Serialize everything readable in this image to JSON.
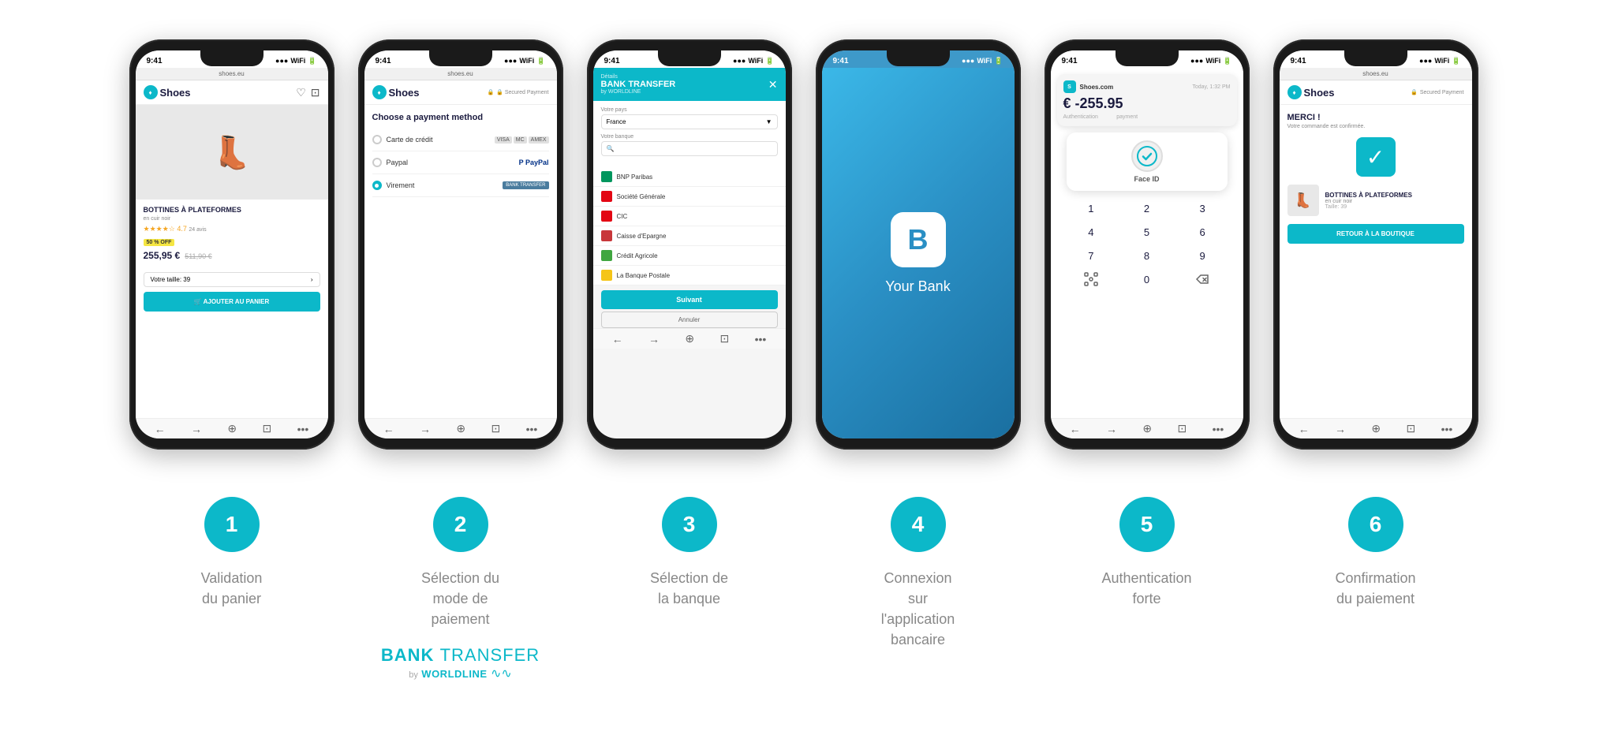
{
  "status_bar": {
    "time": "9:41",
    "signal": "●●●",
    "wifi": "WiFi",
    "battery": "⬛"
  },
  "phones": [
    {
      "id": "phone1",
      "browser_url": "shoes.eu",
      "header": {
        "logo": "Shoes",
        "icon1": "♡",
        "icon2": "⊡"
      },
      "product": {
        "name": "BOTTINES À PLATEFORMES",
        "sub": "en cuir noir",
        "stars": "★★★★☆",
        "rating": "4.7",
        "reviews": "24 avis",
        "badge": "50 % OFF",
        "price": "255,95 €",
        "price_old": "511,90 €",
        "size_label": "Votre taille: 39",
        "cta": "🛒 AJOUTER AU PANIER"
      },
      "bottom": [
        "←",
        "→",
        "⊕",
        "⊡",
        "•••"
      ]
    },
    {
      "id": "phone2",
      "browser_url": "shoes.eu",
      "header": {
        "logo": "Shoes",
        "secured": "🔒 Secured Payment"
      },
      "title": "Choose a payment method",
      "options": [
        {
          "label": "Carte de crédit",
          "type": "cards",
          "selected": false
        },
        {
          "label": "Paypal",
          "type": "paypal",
          "selected": false
        },
        {
          "label": "Virement",
          "type": "bank_transfer",
          "selected": true
        }
      ],
      "bottom": [
        "←",
        "→",
        "⊕",
        "⊡",
        "•••"
      ]
    },
    {
      "id": "phone3",
      "header_title": "BANK TRANSFER",
      "header_sub": "by WORLDLINE",
      "details_label": "Détails",
      "country_label": "Votre pays",
      "country_value": "France",
      "bank_label": "Votre banque",
      "banks": [
        {
          "name": "BNP Paribas",
          "color": "#00965e"
        },
        {
          "name": "Société Générale",
          "color": "#e30613"
        },
        {
          "name": "CIC",
          "color": "#e30613"
        },
        {
          "name": "Caisse d'Epargne",
          "color": "#c8373a"
        },
        {
          "name": "Crédit Agricole",
          "color": "#40a640"
        },
        {
          "name": "La Banque Postale",
          "color": "#f5c518"
        }
      ],
      "cta": "Suivant",
      "cancel": "Annuler",
      "bottom": [
        "←",
        "→",
        "⊕",
        "⊡",
        "•••"
      ]
    },
    {
      "id": "phone4",
      "bank_letter": "B",
      "bank_name": "Your Bank"
    },
    {
      "id": "phone5",
      "notif_app": "Shoes.com",
      "notif_time": "Today, 1:32 PM",
      "amount": "€ -255.95",
      "notif_sub": "Authentication",
      "faceid_label": "Face ID",
      "pin_keys": [
        [
          "1",
          "2",
          "3"
        ],
        [
          "4",
          "5",
          "6"
        ],
        [
          "7",
          "8",
          "9"
        ],
        [
          "⊡",
          "0",
          "⌫"
        ]
      ],
      "bottom": [
        "←",
        "→",
        "⊕",
        "⊡",
        "•••"
      ]
    },
    {
      "id": "phone6",
      "browser_url": "shoes.eu",
      "header": {
        "logo": "Shoes",
        "secured": "🔒 Secured Payment"
      },
      "merci": "MERCI !",
      "sub": "Votre commande est confirmée.",
      "check": "✓",
      "product_name": "BOTTINES À PLATEFORMES",
      "product_sub": "en cuir noir",
      "taille": "Taille: 39",
      "return_btn": "RETOUR À LA BOUTIQUE",
      "bottom": [
        "←",
        "→",
        "⊕",
        "⊡",
        "•••"
      ]
    }
  ],
  "steps": [
    {
      "number": "1",
      "label": "Validation\ndu panier"
    },
    {
      "number": "2",
      "label": "Sélection du\nmode de\npaiement"
    },
    {
      "number": "3",
      "label": "Sélection de\nla banque"
    },
    {
      "number": "4",
      "label": "Connexion\nsur\nl'application\nbancaire"
    },
    {
      "number": "5",
      "label": "Authentication\nforte"
    },
    {
      "number": "6",
      "label": "Confirmation\ndu paiement"
    }
  ],
  "brand": {
    "bank": "BANK",
    "transfer": "TRANSFER",
    "by": "by",
    "worldline": "WORLDLINE"
  }
}
